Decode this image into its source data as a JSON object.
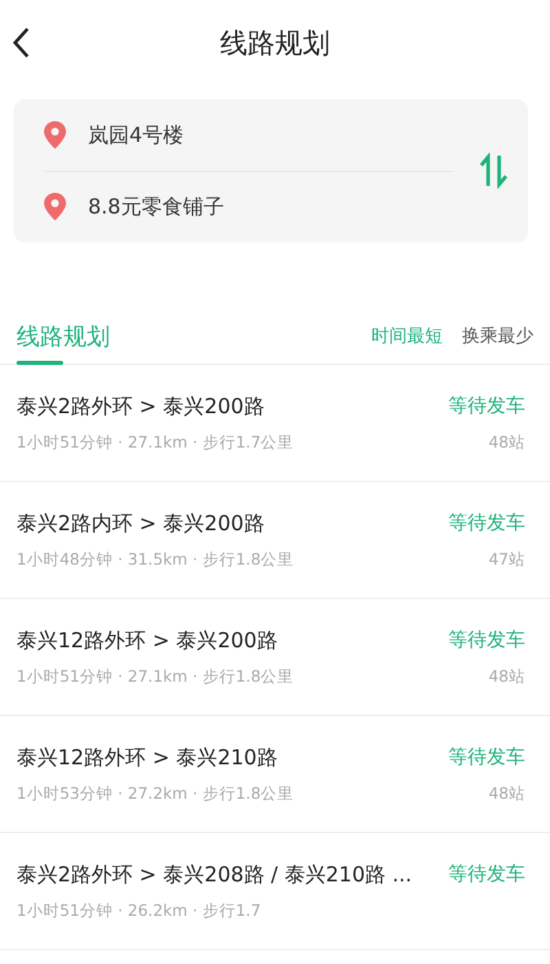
{
  "header": {
    "title": "线路规划"
  },
  "locations": [
    {
      "name": "岚园4号楼"
    },
    {
      "name": "8.8元零食铺子"
    }
  ],
  "section": {
    "title": "线路规划",
    "selected": true
  },
  "sort_options": [
    {
      "label": "时间最短",
      "selected": true
    },
    {
      "label": "换乘最少",
      "selected": false
    }
  ],
  "routes": [
    {
      "title": "泰兴2路外环 > 泰兴200路",
      "status": "等待发车",
      "details": "1小时51分钟 · 27.1km · 步行1.7公里",
      "stops": "48站"
    },
    {
      "title": "泰兴2路内环 > 泰兴200路",
      "status": "等待发车",
      "details": "1小时48分钟 · 31.5km · 步行1.8公里",
      "stops": "47站"
    },
    {
      "title": "泰兴12路外环 > 泰兴200路",
      "status": "等待发车",
      "details": "1小时51分钟 · 27.1km · 步行1.8公里",
      "stops": "48站"
    },
    {
      "title": "泰兴12路外环 > 泰兴210路",
      "status": "等待发车",
      "details": "1小时53分钟 · 27.2km · 步行1.8公里",
      "stops": "48站"
    },
    {
      "title": "泰兴2路外环 > 泰兴208路 / 泰兴210路 ...",
      "status": "等待发车",
      "details": "1小时51分钟 · 26.2km · 步行1.7"
    }
  ]
}
